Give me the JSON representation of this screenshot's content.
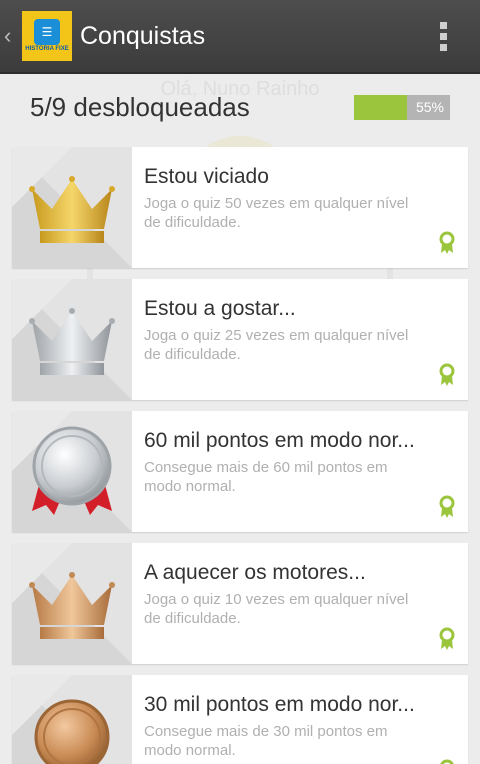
{
  "app": {
    "title": "Conquistas",
    "logo_text": "HISTÓRIA FIXE",
    "accent": "#9bc53d"
  },
  "header": {
    "greeting": "Olá, Nuno Rainho",
    "summary": "5/9 desbloqueadas",
    "progress_percent": 55,
    "progress_label": "55%"
  },
  "achievements": [
    {
      "title": "Estou viciado",
      "description": "Joga o quiz 50 vezes em qualquer nível de dificuldade.",
      "badge": "gold-crown-icon"
    },
    {
      "title": "Estou a gostar...",
      "description": "Joga o quiz 25 vezes em qualquer nível de dificuldade.",
      "badge": "silver-crown-icon"
    },
    {
      "title": "60 mil pontos em modo nor...",
      "description": "Consegue mais de 60 mil pontos em modo normal.",
      "badge": "silver-medal-icon"
    },
    {
      "title": "A aquecer os motores...",
      "description": "Joga o quiz 10 vezes em qualquer nível de dificuldade.",
      "badge": "bronze-crown-icon"
    },
    {
      "title": "30 mil pontos em modo nor...",
      "description": "Consegue mais de 30 mil pontos em modo normal.",
      "badge": "bronze-medal-icon"
    }
  ]
}
